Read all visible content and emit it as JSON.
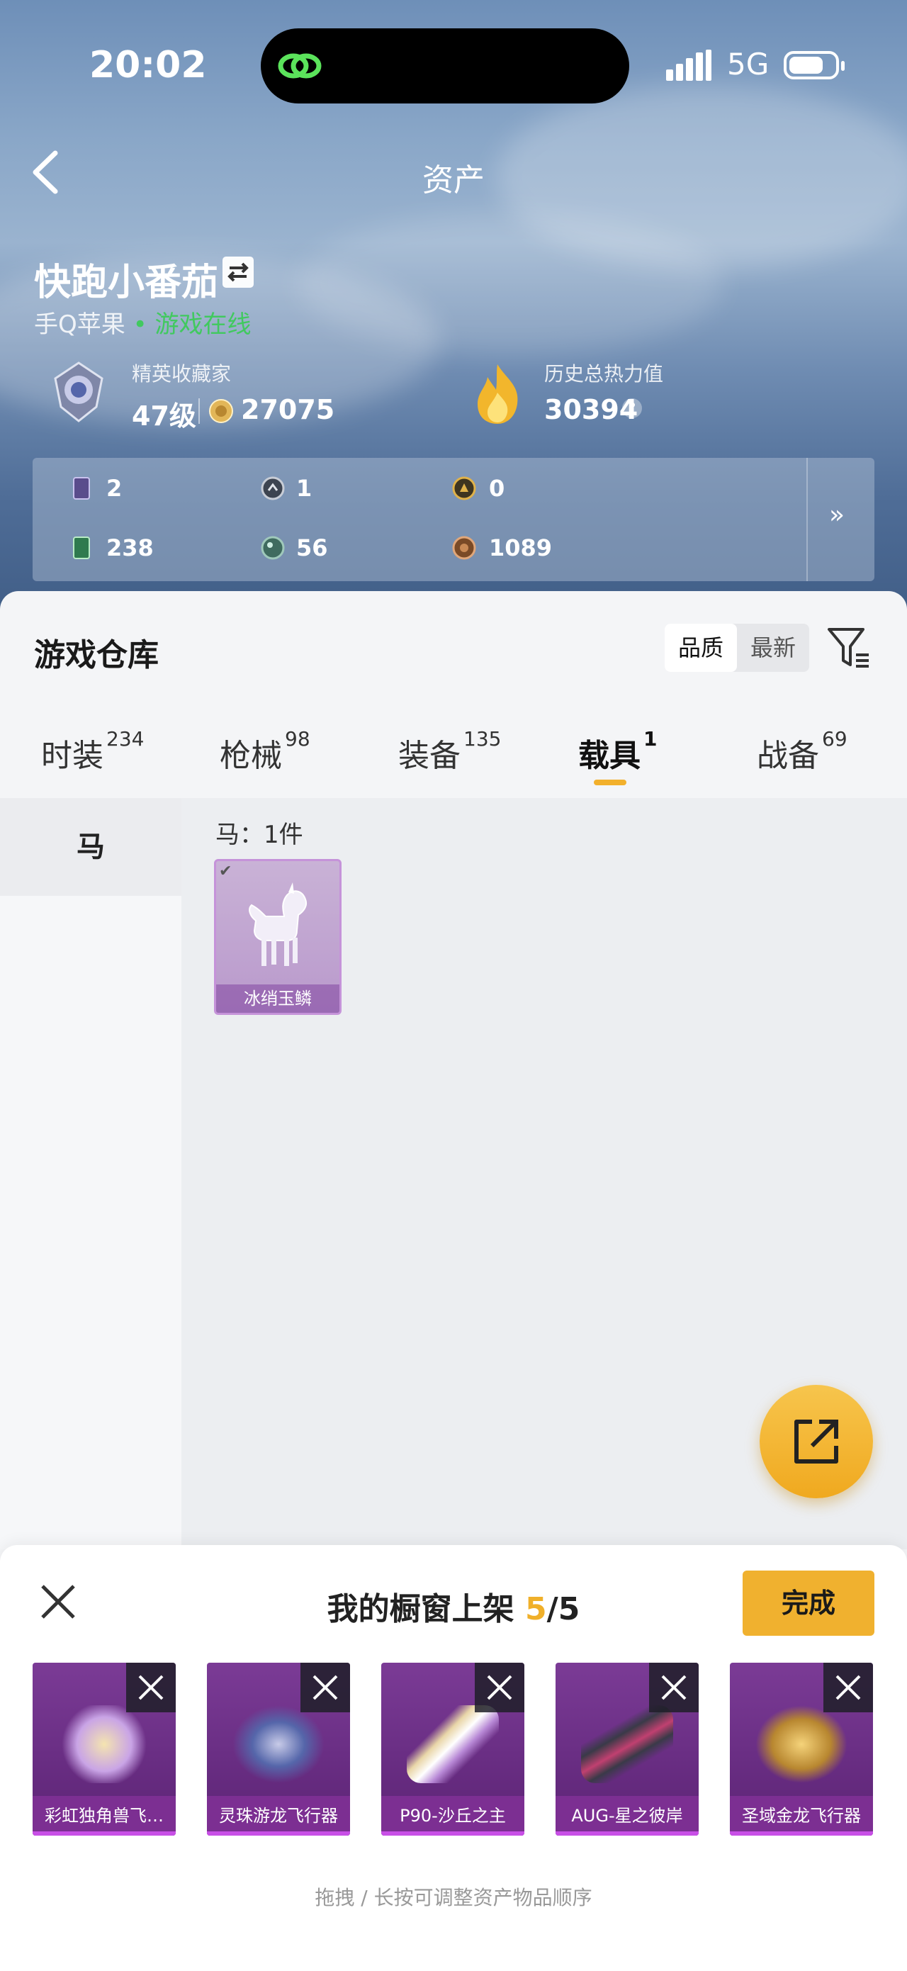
{
  "status_bar": {
    "time": "20:02",
    "network": "5G",
    "battery_level": 0.75
  },
  "header": {
    "title": "资产"
  },
  "user": {
    "name": "快跑小番茄",
    "platform": "手Q苹果",
    "online_status": "• 游戏在线"
  },
  "stats": {
    "collector_label": "精英收藏家",
    "level": "47级",
    "coins": "27075",
    "heat_label": "历史总热力值",
    "heat_value": "30394",
    "heat_help": "?"
  },
  "currencies": [
    {
      "icon": "purple-card-icon",
      "value": "2"
    },
    {
      "icon": "silver-coin-icon",
      "value": "1"
    },
    {
      "icon": "gold-coin-icon",
      "value": "0"
    },
    {
      "icon": "green-card-icon",
      "value": "238"
    },
    {
      "icon": "jade-orb-icon",
      "value": "56"
    },
    {
      "icon": "bronze-coin-icon",
      "value": "1089"
    }
  ],
  "currency_more": "»",
  "warehouse": {
    "title": "游戏仓库",
    "sort_options": [
      "品质",
      "最新"
    ],
    "sort_selected": "品质"
  },
  "tabs": [
    {
      "label": "时装",
      "count": "234"
    },
    {
      "label": "枪械",
      "count": "98"
    },
    {
      "label": "装备",
      "count": "135"
    },
    {
      "label": "载具",
      "count": "1",
      "active": true
    },
    {
      "label": "战备",
      "count": "69"
    }
  ],
  "sidebar": {
    "items": [
      {
        "label": "马"
      }
    ]
  },
  "content": {
    "count_label": "马：1件",
    "items": [
      {
        "name": "冰绡玉鳞",
        "checked": true
      }
    ]
  },
  "showcase": {
    "title_prefix": "我的橱窗上架 ",
    "current": "5",
    "total": "/5",
    "done_label": "完成",
    "items": [
      {
        "name": "彩虹独角兽飞…",
        "art": "unicorn-emblem"
      },
      {
        "name": "灵珠游龙飞行器",
        "art": "dragon-glider"
      },
      {
        "name": "P90-沙丘之主",
        "art": "p90-gun"
      },
      {
        "name": "AUG-星之彼岸",
        "art": "aug-rifle"
      },
      {
        "name": "圣域金龙飞行器",
        "art": "golden-dragon"
      }
    ],
    "hint": "拖拽 / 长按可调整资产物品顺序"
  },
  "colors": {
    "accent": "#f0b12f",
    "online": "#41c95f",
    "rarity_purple": "#7c2f92"
  }
}
